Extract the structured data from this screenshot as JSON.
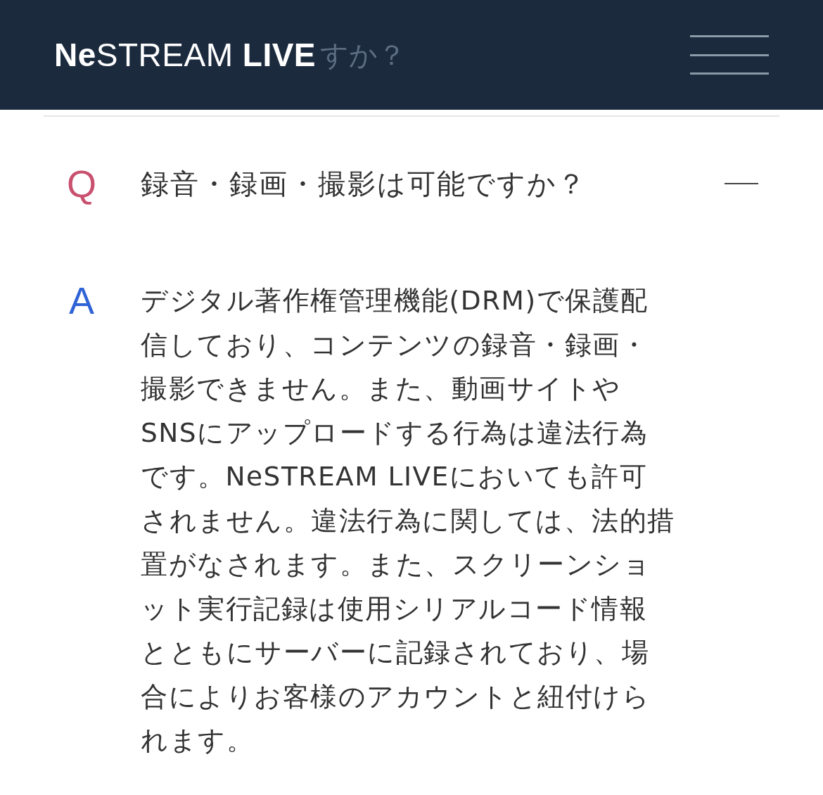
{
  "header": {
    "logo": "**Ne**STREAM **LIVE**",
    "behind_text": "すか？"
  },
  "faq": [
    {
      "question_mark": "Q",
      "question": "録音・録画・撮影は可能ですか？",
      "expanded": true,
      "answer_mark": "A",
      "answer": "デジタル著作権管理機能(DRM)で保護配信しており、コンテンツの録音・録画・撮影できません。また、動画サイトやSNSにアップロードする行為は違法行為です。NeSTREAM LIVEにおいても許可されません。違法行為に関しては、法的措置がなされます。また、スクリーンショット実行記録は使用シリアルコード情報とともにサーバーに記録されており、場合によりお客様のアカウントと紐付けられます。"
    }
  ]
}
